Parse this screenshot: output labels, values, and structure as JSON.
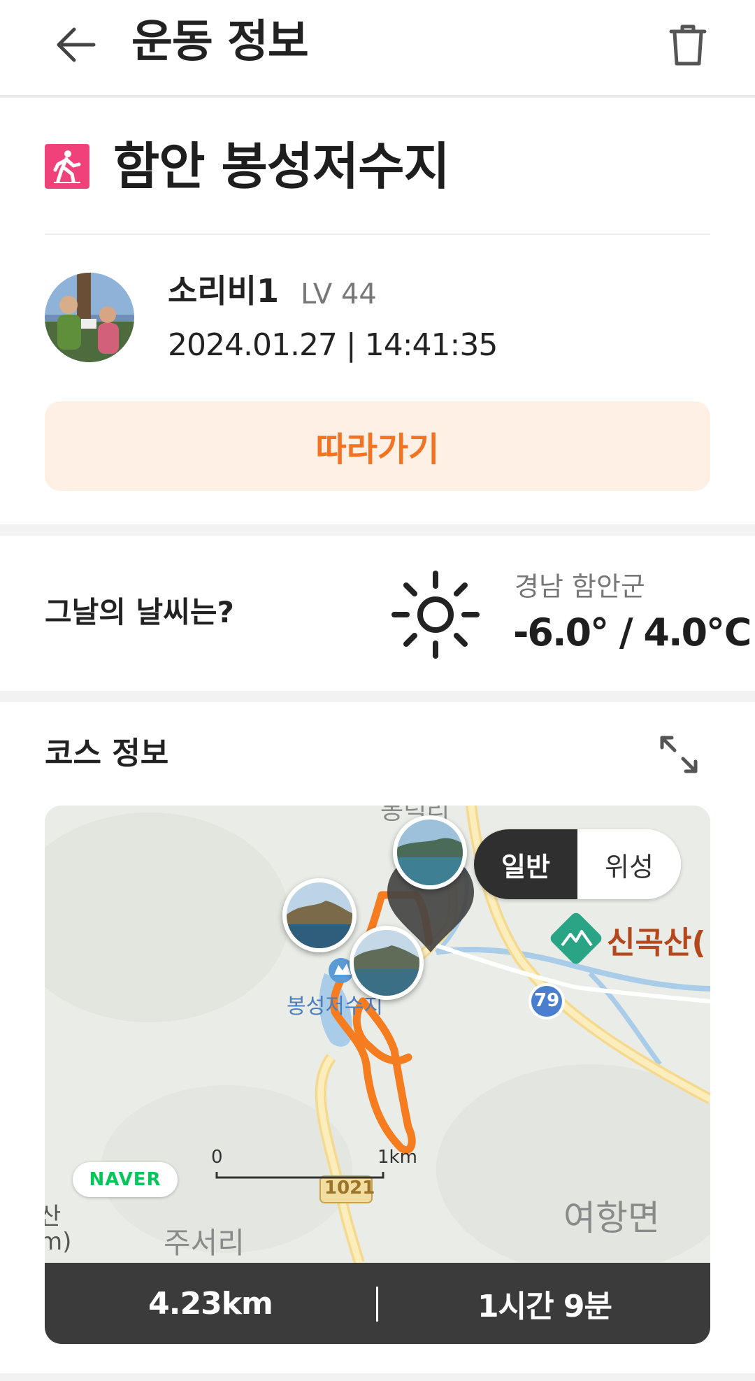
{
  "header": {
    "title": "운동 정보"
  },
  "activity": {
    "icon": "walking-person-icon",
    "title": "함안 봉성저수지"
  },
  "user": {
    "name": "소리비1",
    "level": "LV 44",
    "datetime": "2024.01.27 | 14:41:35"
  },
  "follow_button": "따라가기",
  "weather": {
    "question": "그날의 날씨는?",
    "icon": "sun-icon",
    "region": "경남 함안군",
    "temps": "-6.0° / 4.0℃"
  },
  "course": {
    "heading": "코스 정보",
    "map": {
      "toggle_normal": "일반",
      "toggle_satellite": "위성",
      "labels": {
        "village_top": "봉덕리",
        "mountain": "신곡산(",
        "reservoir": "봉성저수지",
        "route_79": "79",
        "route_1021": "1021",
        "scale_zero": "0",
        "scale_km": "1km",
        "town": "여항면",
        "village_bottom": "주서리",
        "left_edge_1": "산",
        "left_edge_2": "m)"
      },
      "provider": "NAVER"
    },
    "distance": "4.23km",
    "duration": "1시간 9분"
  },
  "colors": {
    "accent": "#f37321",
    "badge": "#f0417a",
    "follow_bg": "#fff0e6",
    "stats_bg": "#3b3b3b",
    "route": "#f57c1f"
  }
}
